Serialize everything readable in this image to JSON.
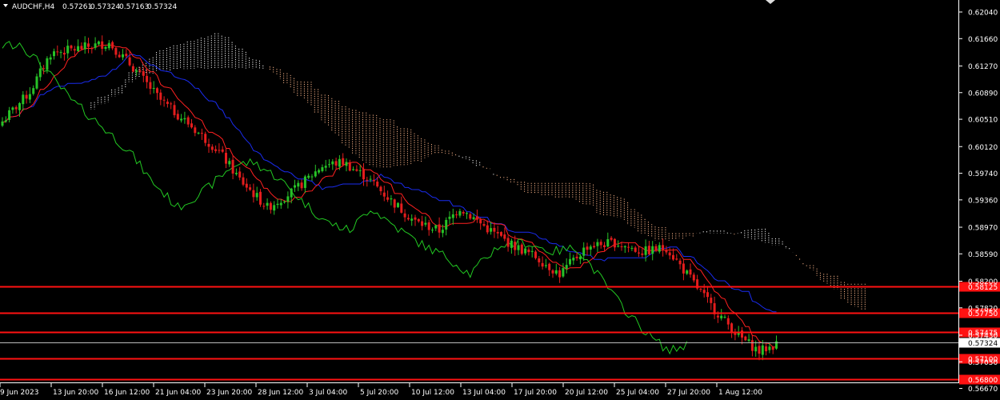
{
  "header": {
    "symbol_timeframe": "AUDCHF,H4",
    "open": "0.57261",
    "high": "0.57324",
    "low": "0.57163",
    "close": "0.57324"
  },
  "chart_data": {
    "type": "candlestick",
    "symbol": "AUDCHF",
    "timeframe": "H4",
    "y_ticks": [
      "0.62040",
      "0.61660",
      "0.61270",
      "0.60890",
      "0.60510",
      "0.60120",
      "0.59740",
      "0.59360",
      "0.58970",
      "0.58590",
      "0.58200",
      "0.57820",
      "0.57430",
      "0.57050",
      "0.56670"
    ],
    "x_ticks": [
      "9 Jun 2023",
      "13 Jun 20:00",
      "16 Jun 12:00",
      "21 Jun 04:00",
      "23 Jun 20:00",
      "28 Jun 12:00",
      "3 Jul 04:00",
      "5 Jul 20:00",
      "10 Jul 12:00",
      "13 Jul 04:00",
      "17 Jul 20:00",
      "20 Jul 12:00",
      "25 Jul 04:00",
      "27 Jul 20:00",
      "1 Aug 12:00"
    ],
    "ylim": [
      0.5659,
      0.6222
    ],
    "price_lines": [
      {
        "label": "0.58125",
        "value": 0.58125
      },
      {
        "label": "0.57750",
        "value": 0.5775
      },
      {
        "label": "0.57475",
        "value": 0.57475
      },
      {
        "label": "0.57100",
        "value": 0.571
      },
      {
        "label": "0.56800",
        "value": 0.568
      }
    ],
    "current_price": {
      "label": "0.57324",
      "value": 0.57324
    },
    "colors": {
      "background": "#000000",
      "axis": "#ffffff",
      "bull": "#27c227",
      "bear": "#e41d1d",
      "tenkan": "#ff2020",
      "kijun": "#1a2cf0",
      "chikou": "#22c822",
      "cloud_a": "#f5b085",
      "cloud_b": "#f2f2f2",
      "level": "#ff1212"
    },
    "anchors": [
      [
        0,
        0.6048
      ],
      [
        8,
        0.609
      ],
      [
        14,
        0.6145
      ],
      [
        22,
        0.6152
      ],
      [
        31,
        0.616
      ],
      [
        38,
        0.6125
      ],
      [
        46,
        0.6078
      ],
      [
        54,
        0.6045
      ],
      [
        63,
        0.6005
      ],
      [
        69,
        0.5965
      ],
      [
        77,
        0.5925
      ],
      [
        85,
        0.595
      ],
      [
        93,
        0.5985
      ],
      [
        99,
        0.599
      ],
      [
        106,
        0.5968
      ],
      [
        113,
        0.5935
      ],
      [
        120,
        0.5905
      ],
      [
        127,
        0.5892
      ],
      [
        133,
        0.5925
      ],
      [
        141,
        0.5895
      ],
      [
        148,
        0.5872
      ],
      [
        155,
        0.5855
      ],
      [
        162,
        0.583
      ],
      [
        170,
        0.587
      ],
      [
        178,
        0.5875
      ],
      [
        186,
        0.5862
      ],
      [
        193,
        0.5868
      ],
      [
        199,
        0.583
      ],
      [
        206,
        0.5785
      ],
      [
        214,
        0.5742
      ],
      [
        220,
        0.572
      ],
      [
        225,
        0.573
      ]
    ]
  }
}
